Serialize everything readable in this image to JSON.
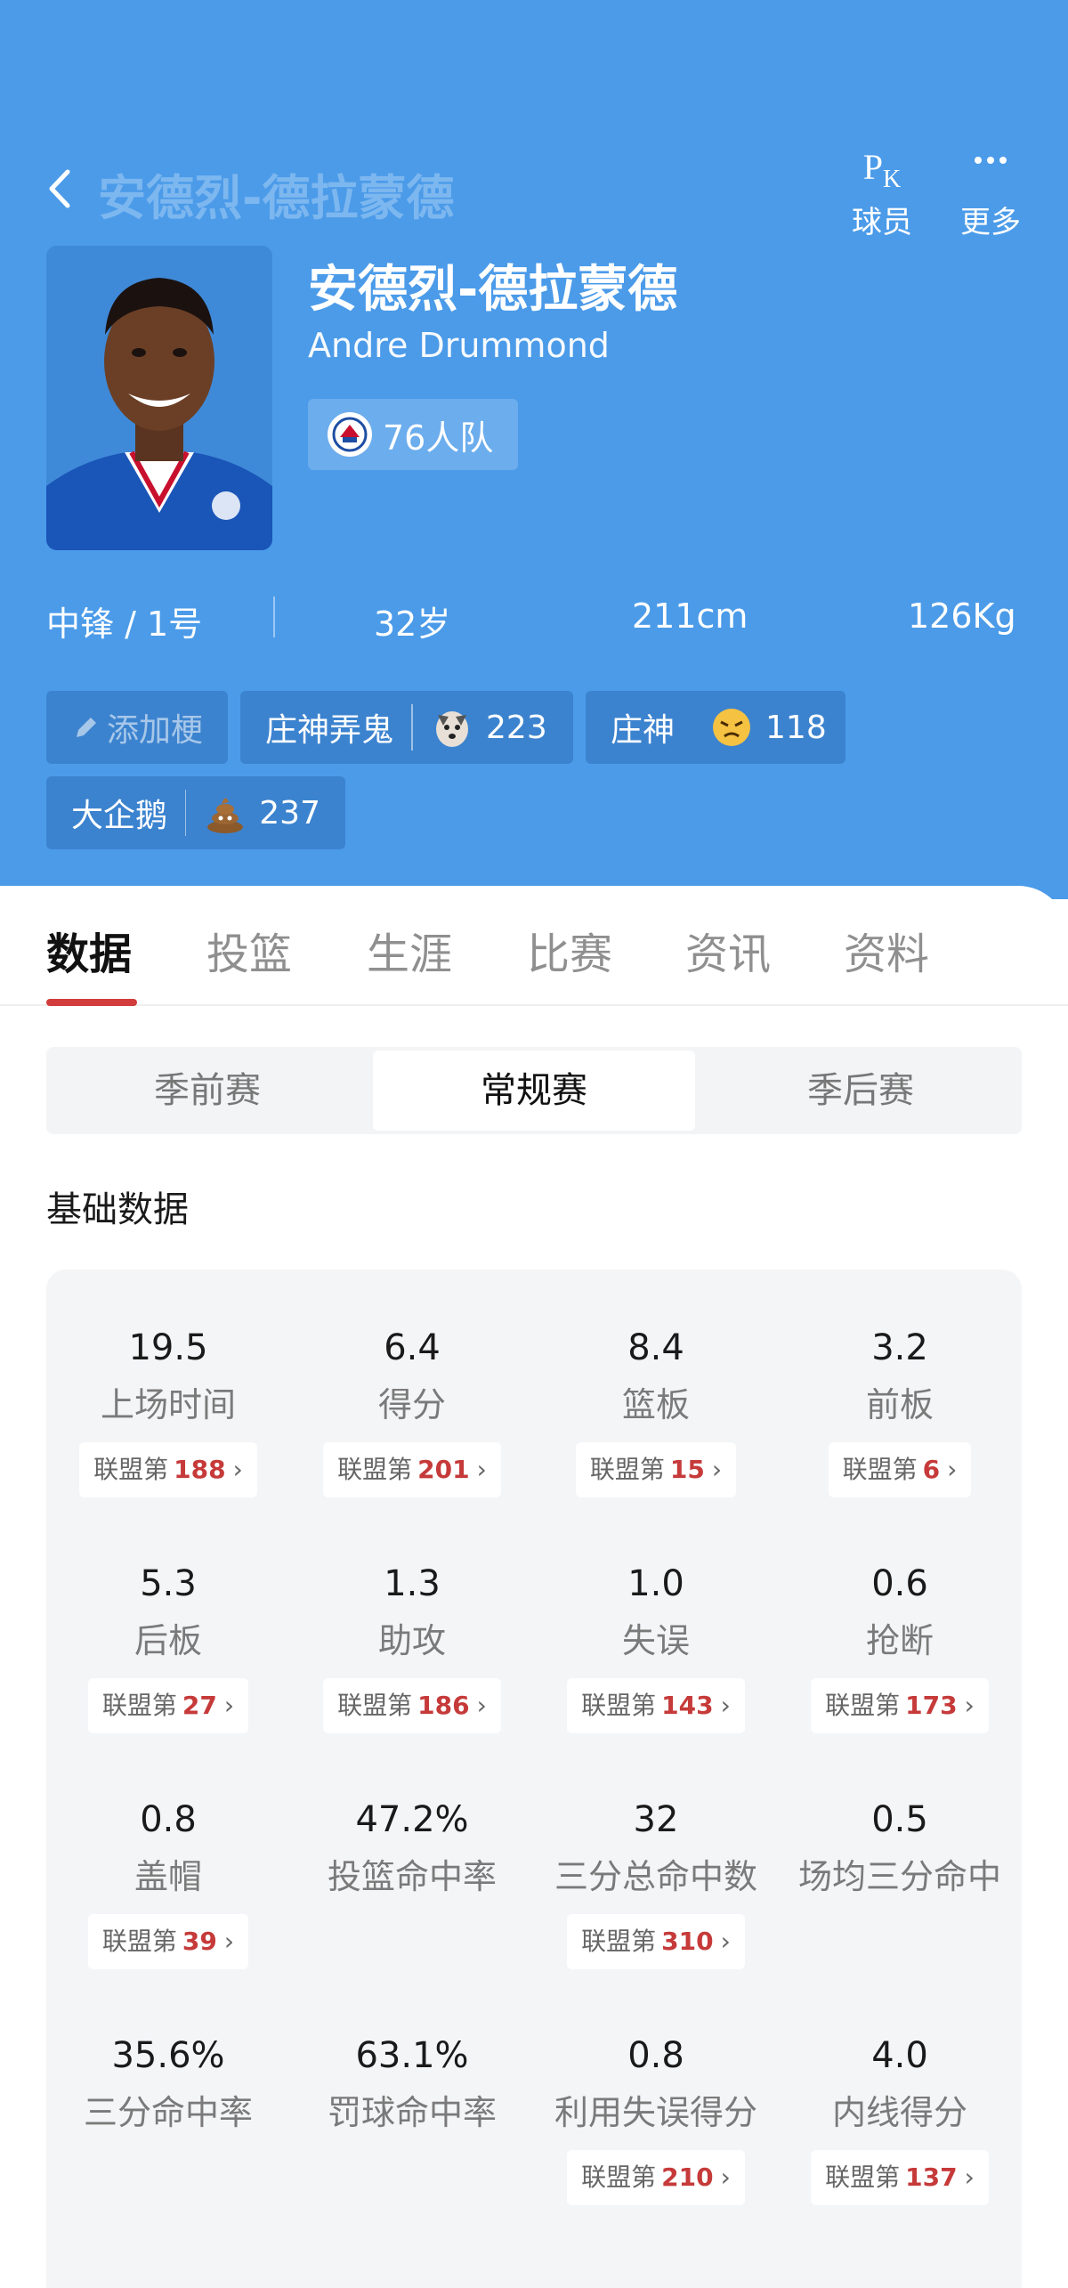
{
  "nav": {
    "title": "安德烈-德拉蒙德",
    "pk_label": "球员",
    "more_label": "更多"
  },
  "player": {
    "name_zh": "安德烈-德拉蒙德",
    "name_en": "Andre Drummond",
    "team": "76人队",
    "position": "中锋 / 1号",
    "age": "32岁",
    "height": "211cm",
    "weight": "126Kg"
  },
  "tags": {
    "add_label": "添加梗",
    "items": [
      {
        "label": "庄神弄鬼",
        "count": "223",
        "emoji": "husky-emoji-icon"
      },
      {
        "label": "庄神",
        "count": "118",
        "emoji": "angry-emoji-icon"
      },
      {
        "label": "大企鹅",
        "count": "237",
        "emoji": "poop-emoji-icon"
      }
    ]
  },
  "tabs": [
    "数据",
    "投篮",
    "生涯",
    "比赛",
    "资讯",
    "资料"
  ],
  "season_tabs": [
    "季前赛",
    "常规赛",
    "季后赛"
  ],
  "section_title": "基础数据",
  "rank_prefix": "联盟第",
  "stats": [
    {
      "value": "19.5",
      "label": "上场时间",
      "rank": "188"
    },
    {
      "value": "6.4",
      "label": "得分",
      "rank": "201"
    },
    {
      "value": "8.4",
      "label": "篮板",
      "rank": "15"
    },
    {
      "value": "3.2",
      "label": "前板",
      "rank": "6"
    },
    {
      "value": "5.3",
      "label": "后板",
      "rank": "27"
    },
    {
      "value": "1.3",
      "label": "助攻",
      "rank": "186"
    },
    {
      "value": "1.0",
      "label": "失误",
      "rank": "143"
    },
    {
      "value": "0.6",
      "label": "抢断",
      "rank": "173"
    },
    {
      "value": "0.8",
      "label": "盖帽",
      "rank": "39"
    },
    {
      "value": "47.2%",
      "label": "投篮命中率",
      "rank": ""
    },
    {
      "value": "32",
      "label": "三分总命中数",
      "rank": "310"
    },
    {
      "value": "0.5",
      "label": "场均三分命中",
      "rank": ""
    },
    {
      "value": "35.6%",
      "label": "三分命中率",
      "rank": ""
    },
    {
      "value": "63.1%",
      "label": "罚球命中率",
      "rank": ""
    },
    {
      "value": "0.8",
      "label": "利用失误得分",
      "rank": "210"
    },
    {
      "value": "4.0",
      "label": "内线得分",
      "rank": "137"
    }
  ],
  "colors": {
    "header_bg": "#4b9be9",
    "accent_red": "#d23c3c"
  }
}
